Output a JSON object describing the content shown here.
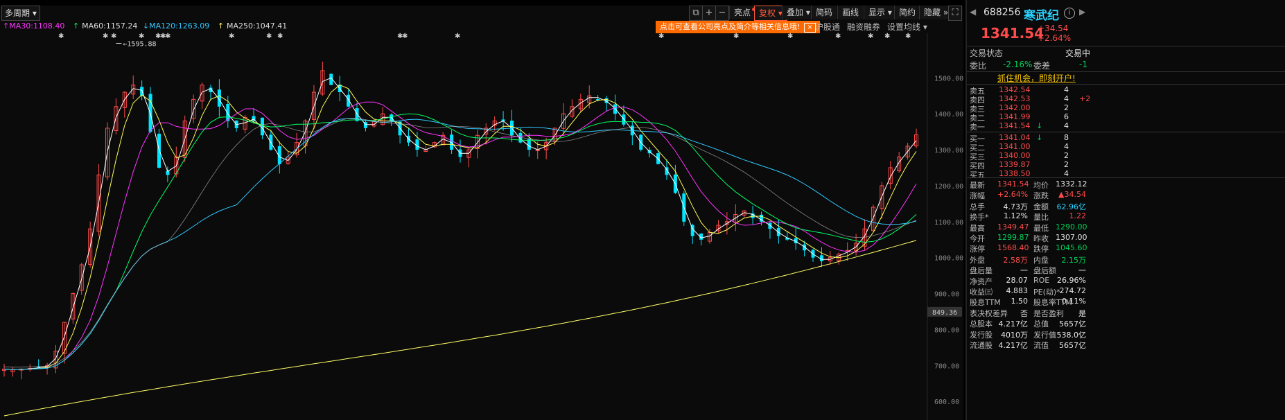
{
  "toolbar": {
    "period_label": "多周期",
    "icons": [
      "copy-icon",
      "plus-icon",
      "minus-icon"
    ],
    "buttons": [
      {
        "name": "highlight-button",
        "label": "亮点",
        "dot": true
      },
      {
        "name": "restore-rights-button",
        "label": "复权",
        "dropdown": true,
        "active": true
      },
      {
        "name": "overlay-button",
        "label": "叠加",
        "dropdown": true
      },
      {
        "name": "brief-button",
        "label": "简码"
      },
      {
        "name": "draw-line-button",
        "label": "画线"
      },
      {
        "name": "display-button",
        "label": "显示",
        "dropdown": true
      },
      {
        "name": "simple-button",
        "label": "简约"
      },
      {
        "name": "hide-button",
        "label": "隐藏",
        "chevron": "»"
      }
    ]
  },
  "ma_legend": [
    {
      "label": "MA30:1108.40",
      "arrow": "↑",
      "color": "#ff33ff"
    },
    {
      "label": "MA60:1157.24",
      "arrow": "↑",
      "color": "#00ff66"
    },
    {
      "label": "MA120:1263.09",
      "arrow": "↓",
      "color": "#30c8ff"
    },
    {
      "label": "MA250:1047.41",
      "arrow": "↑",
      "color": "#ffff66"
    }
  ],
  "banner": {
    "text": "点击可查看公司亮点及简介等相关信息哦!",
    "close": "×"
  },
  "sub_links": [
    "沪股通",
    "融资融券",
    "设置均线"
  ],
  "colors": {
    "up": "#ff4b4b",
    "down": "#00e5ff",
    "bg": "#0b0b0b"
  },
  "chart_data": {
    "type": "candlestick",
    "ylim": [
      560,
      1620
    ],
    "y_ticks": [
      "1500.00",
      "1400.00",
      "1300.00",
      "1200.00",
      "1100.00",
      "1000.00",
      "900.00",
      "800.00",
      "700.00",
      "600.00"
    ],
    "y_tick_values": [
      1500,
      1400,
      1300,
      1200,
      1100,
      1000,
      900,
      800,
      700,
      600
    ],
    "price_marker": "849.36",
    "price_marker_value": 849.36,
    "max_label": "1595.88",
    "max_value": 1595.88,
    "close_values": [
      690,
      688,
      690,
      692,
      695,
      700,
      740,
      820,
      900,
      980,
      1080,
      1230,
      1360,
      1420,
      1460,
      1480,
      1450,
      1350,
      1250,
      1230,
      1280,
      1380,
      1440,
      1480,
      1460,
      1420,
      1380,
      1360,
      1390,
      1380,
      1340,
      1300,
      1260,
      1280,
      1320,
      1380,
      1460,
      1520,
      1480,
      1460,
      1420,
      1380,
      1360,
      1380,
      1400,
      1380,
      1340,
      1320,
      1300,
      1300,
      1320,
      1340,
      1300,
      1280,
      1300,
      1340,
      1360,
      1380,
      1380,
      1340,
      1320,
      1300,
      1300,
      1320,
      1360,
      1400,
      1420,
      1440,
      1450,
      1440,
      1430,
      1400,
      1370,
      1340,
      1300,
      1290,
      1260,
      1230,
      1180,
      1100,
      1060,
      1050,
      1070,
      1090,
      1100,
      1120,
      1130,
      1110,
      1100,
      1080,
      1060,
      1050,
      1040,
      1020,
      1000,
      990,
      1000,
      1010,
      1020,
      1040,
      1080,
      1140,
      1200,
      1250,
      1280,
      1310,
      1341.54
    ],
    "series": [
      {
        "name": "MA30",
        "color": "#ff33ff"
      },
      {
        "name": "MA60",
        "color": "#00ff66"
      },
      {
        "name": "MA120",
        "color": "#30c8ff"
      },
      {
        "name": "MA250",
        "color": "#ffff66"
      }
    ]
  },
  "quote": {
    "code": "688256",
    "name": "寒武纪",
    "price": "1341.54",
    "change": "+34.54",
    "change_pct": "+2.64%",
    "status_label": "交易状态",
    "status_value": "交易中",
    "wb_label": "委比",
    "wb_value": "-2.16%",
    "wc_label": "委差",
    "wc_value": "-1",
    "promo": "抓住机会，即刻开户!"
  },
  "asks": [
    {
      "label": "卖五",
      "price": "1342.54",
      "vol": "4",
      "extra": ""
    },
    {
      "label": "卖四",
      "price": "1342.53",
      "vol": "4",
      "extra": "+2"
    },
    {
      "label": "卖三",
      "price": "1342.00",
      "vol": "2",
      "extra": ""
    },
    {
      "label": "卖二",
      "price": "1341.99",
      "vol": "6",
      "extra": ""
    },
    {
      "label": "卖一",
      "price": "1341.54",
      "vol": "4",
      "extra": "",
      "arrow": "↓"
    }
  ],
  "bids": [
    {
      "label": "买一",
      "price": "1341.04",
      "vol": "8",
      "arrow": "↓"
    },
    {
      "label": "买二",
      "price": "1341.00",
      "vol": "4"
    },
    {
      "label": "买三",
      "price": "1340.00",
      "vol": "2"
    },
    {
      "label": "买四",
      "price": "1339.87",
      "vol": "2"
    },
    {
      "label": "买五",
      "price": "1338.50",
      "vol": "4"
    }
  ],
  "stats": [
    {
      "l1": "最新",
      "v1": "1341.54",
      "c1": "red",
      "l2": "均价",
      "v2": "1332.12",
      "c2": "white"
    },
    {
      "l1": "涨幅",
      "v1": "+2.64%",
      "c1": "red",
      "l2": "涨跌",
      "v2": "▲34.54",
      "c2": "red"
    },
    {
      "l1": "总手",
      "v1": "4.73万",
      "c1": "white",
      "l2": "金额",
      "v2": "62.96亿",
      "c2": "cyan"
    },
    {
      "l1": "换手*",
      "v1": "1.12%",
      "c1": "white",
      "l2": "量比",
      "v2": "1.22",
      "c2": "red"
    },
    {
      "l1": "最高",
      "v1": "1349.47",
      "c1": "red",
      "l2": "最低",
      "v2": "1290.00",
      "c2": "green"
    },
    {
      "l1": "今开",
      "v1": "1299.87",
      "c1": "green",
      "l2": "昨收",
      "v2": "1307.00",
      "c2": "white"
    },
    {
      "l1": "涨停",
      "v1": "1568.40",
      "c1": "red",
      "l2": "跌停",
      "v2": "1045.60",
      "c2": "green"
    },
    {
      "l1": "外盘",
      "v1": "2.58万",
      "c1": "red",
      "l2": "内盘",
      "v2": "2.15万",
      "c2": "green"
    },
    {
      "l1": "盘后量",
      "v1": "一",
      "c1": "white",
      "l2": "盘后额",
      "v2": "一",
      "c2": "white"
    },
    {
      "l1": "净资产",
      "v1": "28.07",
      "c1": "white",
      "l2": "ROE",
      "v2": "26.96%",
      "c2": "white"
    },
    {
      "l1": "收益㈢",
      "v1": "4.883",
      "c1": "white",
      "l2": "PE(动)*",
      "v2": "274.72",
      "c2": "white"
    },
    {
      "l1": "股息TTM",
      "v1": "1.50",
      "c1": "white",
      "l2": "股息率TTM",
      "v2": "0.11%",
      "c2": "white"
    },
    {
      "l1": "表决权差异",
      "v1": "否",
      "c1": "white",
      "l2": "是否盈利",
      "v2": "是",
      "c2": "white"
    },
    {
      "l1": "总股本",
      "v1": "4.217亿",
      "c1": "white",
      "l2": "总值",
      "v2": "5657亿",
      "c2": "white"
    },
    {
      "l1": "发行股",
      "v1": "4010万",
      "c1": "white",
      "l2": "发行值",
      "v2": "538.0亿",
      "c2": "white"
    },
    {
      "l1": "流通股",
      "v1": "4.217亿",
      "c1": "white",
      "l2": "流值",
      "v2": "5657亿",
      "c2": "white"
    }
  ]
}
